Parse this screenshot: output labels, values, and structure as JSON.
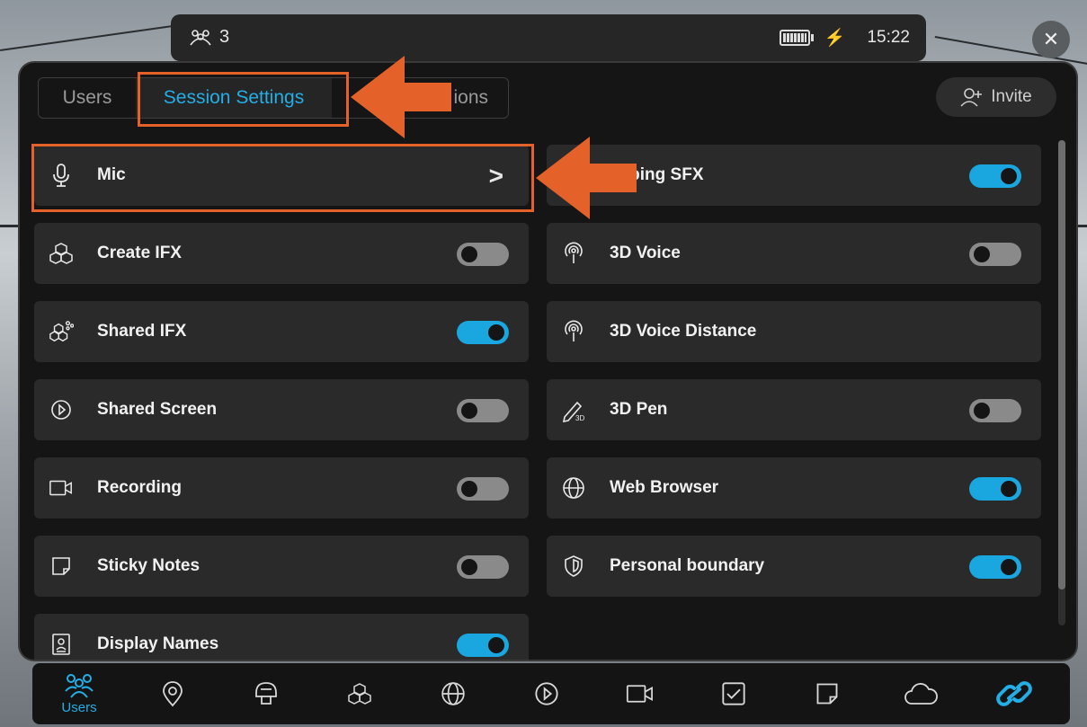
{
  "topbar": {
    "user_count": "3",
    "time": "15:22"
  },
  "tabs": [
    {
      "label": "Users"
    },
    {
      "label": "Session Settings"
    },
    {
      "label": "ions"
    }
  ],
  "invite_label": "Invite",
  "settings_left": [
    {
      "label": "Mic",
      "icon": "mic-icon",
      "control": "chevron"
    },
    {
      "label": "Create IFX",
      "icon": "cubes-icon",
      "control": "toggle",
      "on": false
    },
    {
      "label": "Shared IFX",
      "icon": "shared-cubes-icon",
      "control": "toggle",
      "on": true
    },
    {
      "label": "Shared Screen",
      "icon": "play-circle-icon",
      "control": "toggle",
      "on": false
    },
    {
      "label": "Recording",
      "icon": "video-camera-icon",
      "control": "toggle",
      "on": false
    },
    {
      "label": "Sticky Notes",
      "icon": "sticky-note-icon",
      "control": "toggle",
      "on": false
    },
    {
      "label": "Display Names",
      "icon": "name-badge-icon",
      "control": "toggle",
      "on": true
    }
  ],
  "settings_right": [
    {
      "label": "apping SFX",
      "icon": "sound-icon",
      "control": "toggle",
      "on": true
    },
    {
      "label": "3D Voice",
      "icon": "voice-icon",
      "control": "toggle",
      "on": false
    },
    {
      "label": "3D Voice Distance",
      "icon": "voice-icon",
      "control": "none"
    },
    {
      "label": "3D Pen",
      "icon": "pen-3d-icon",
      "control": "toggle",
      "on": false
    },
    {
      "label": "Web Browser",
      "icon": "globe-icon",
      "control": "toggle",
      "on": true
    },
    {
      "label": "Personal boundary",
      "icon": "shield-icon",
      "control": "toggle",
      "on": true
    }
  ],
  "bottom_nav": [
    {
      "icon": "users-icon",
      "label": "Users",
      "active": true
    },
    {
      "icon": "location-pin-icon"
    },
    {
      "icon": "avatar-icon"
    },
    {
      "icon": "cubes-icon"
    },
    {
      "icon": "globe-icon"
    },
    {
      "icon": "play-circle-icon"
    },
    {
      "icon": "video-camera-icon"
    },
    {
      "icon": "checkbox-icon"
    },
    {
      "icon": "sticky-note-icon"
    },
    {
      "icon": "cloud-icon"
    },
    {
      "icon": "link-icon",
      "active": true
    }
  ],
  "colors": {
    "accent": "#24aee6",
    "annotation": "#e4622a",
    "panel": "#151515",
    "row": "#2a2a2a"
  }
}
